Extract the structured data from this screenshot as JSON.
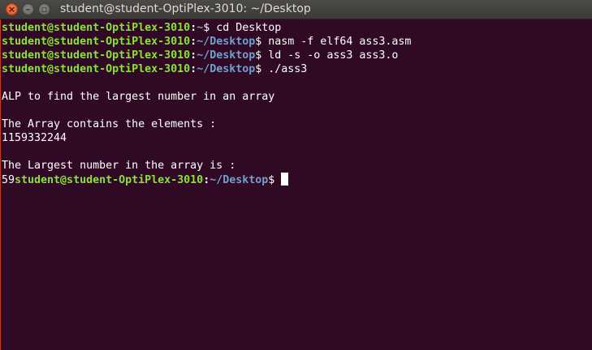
{
  "window": {
    "title": "student@student-OptiPlex-3010: ~/Desktop",
    "close_symbol": "×",
    "minimize_symbol": "–",
    "maximize_symbol": "▫"
  },
  "colors": {
    "background": "#300a24",
    "user": "#8ae234",
    "path": "#729fcf",
    "text": "#ffffff"
  },
  "terminal": {
    "prompt_user": "student@student-OptiPlex-3010",
    "prompt_colon": ":",
    "prompt_suffix": "$ ",
    "lines": [
      {
        "type": "prompt",
        "path": "~",
        "command": "cd Desktop"
      },
      {
        "type": "prompt",
        "path": "~/Desktop",
        "command": "nasm -f elf64 ass3.asm"
      },
      {
        "type": "prompt",
        "path": "~/Desktop",
        "command": "ld -s -o ass3 ass3.o"
      },
      {
        "type": "prompt",
        "path": "~/Desktop",
        "command": "./ass3"
      },
      {
        "type": "output",
        "text": ""
      },
      {
        "type": "output",
        "text": "ALP to find the largest number in an array"
      },
      {
        "type": "output",
        "text": ""
      },
      {
        "type": "output",
        "text": "The Array contains the elements :"
      },
      {
        "type": "output",
        "text": "1159332244"
      },
      {
        "type": "output",
        "text": ""
      },
      {
        "type": "output",
        "text": "The Largest number in the array is :"
      },
      {
        "type": "final",
        "output": "59",
        "path": "~/Desktop",
        "command": ""
      }
    ]
  }
}
